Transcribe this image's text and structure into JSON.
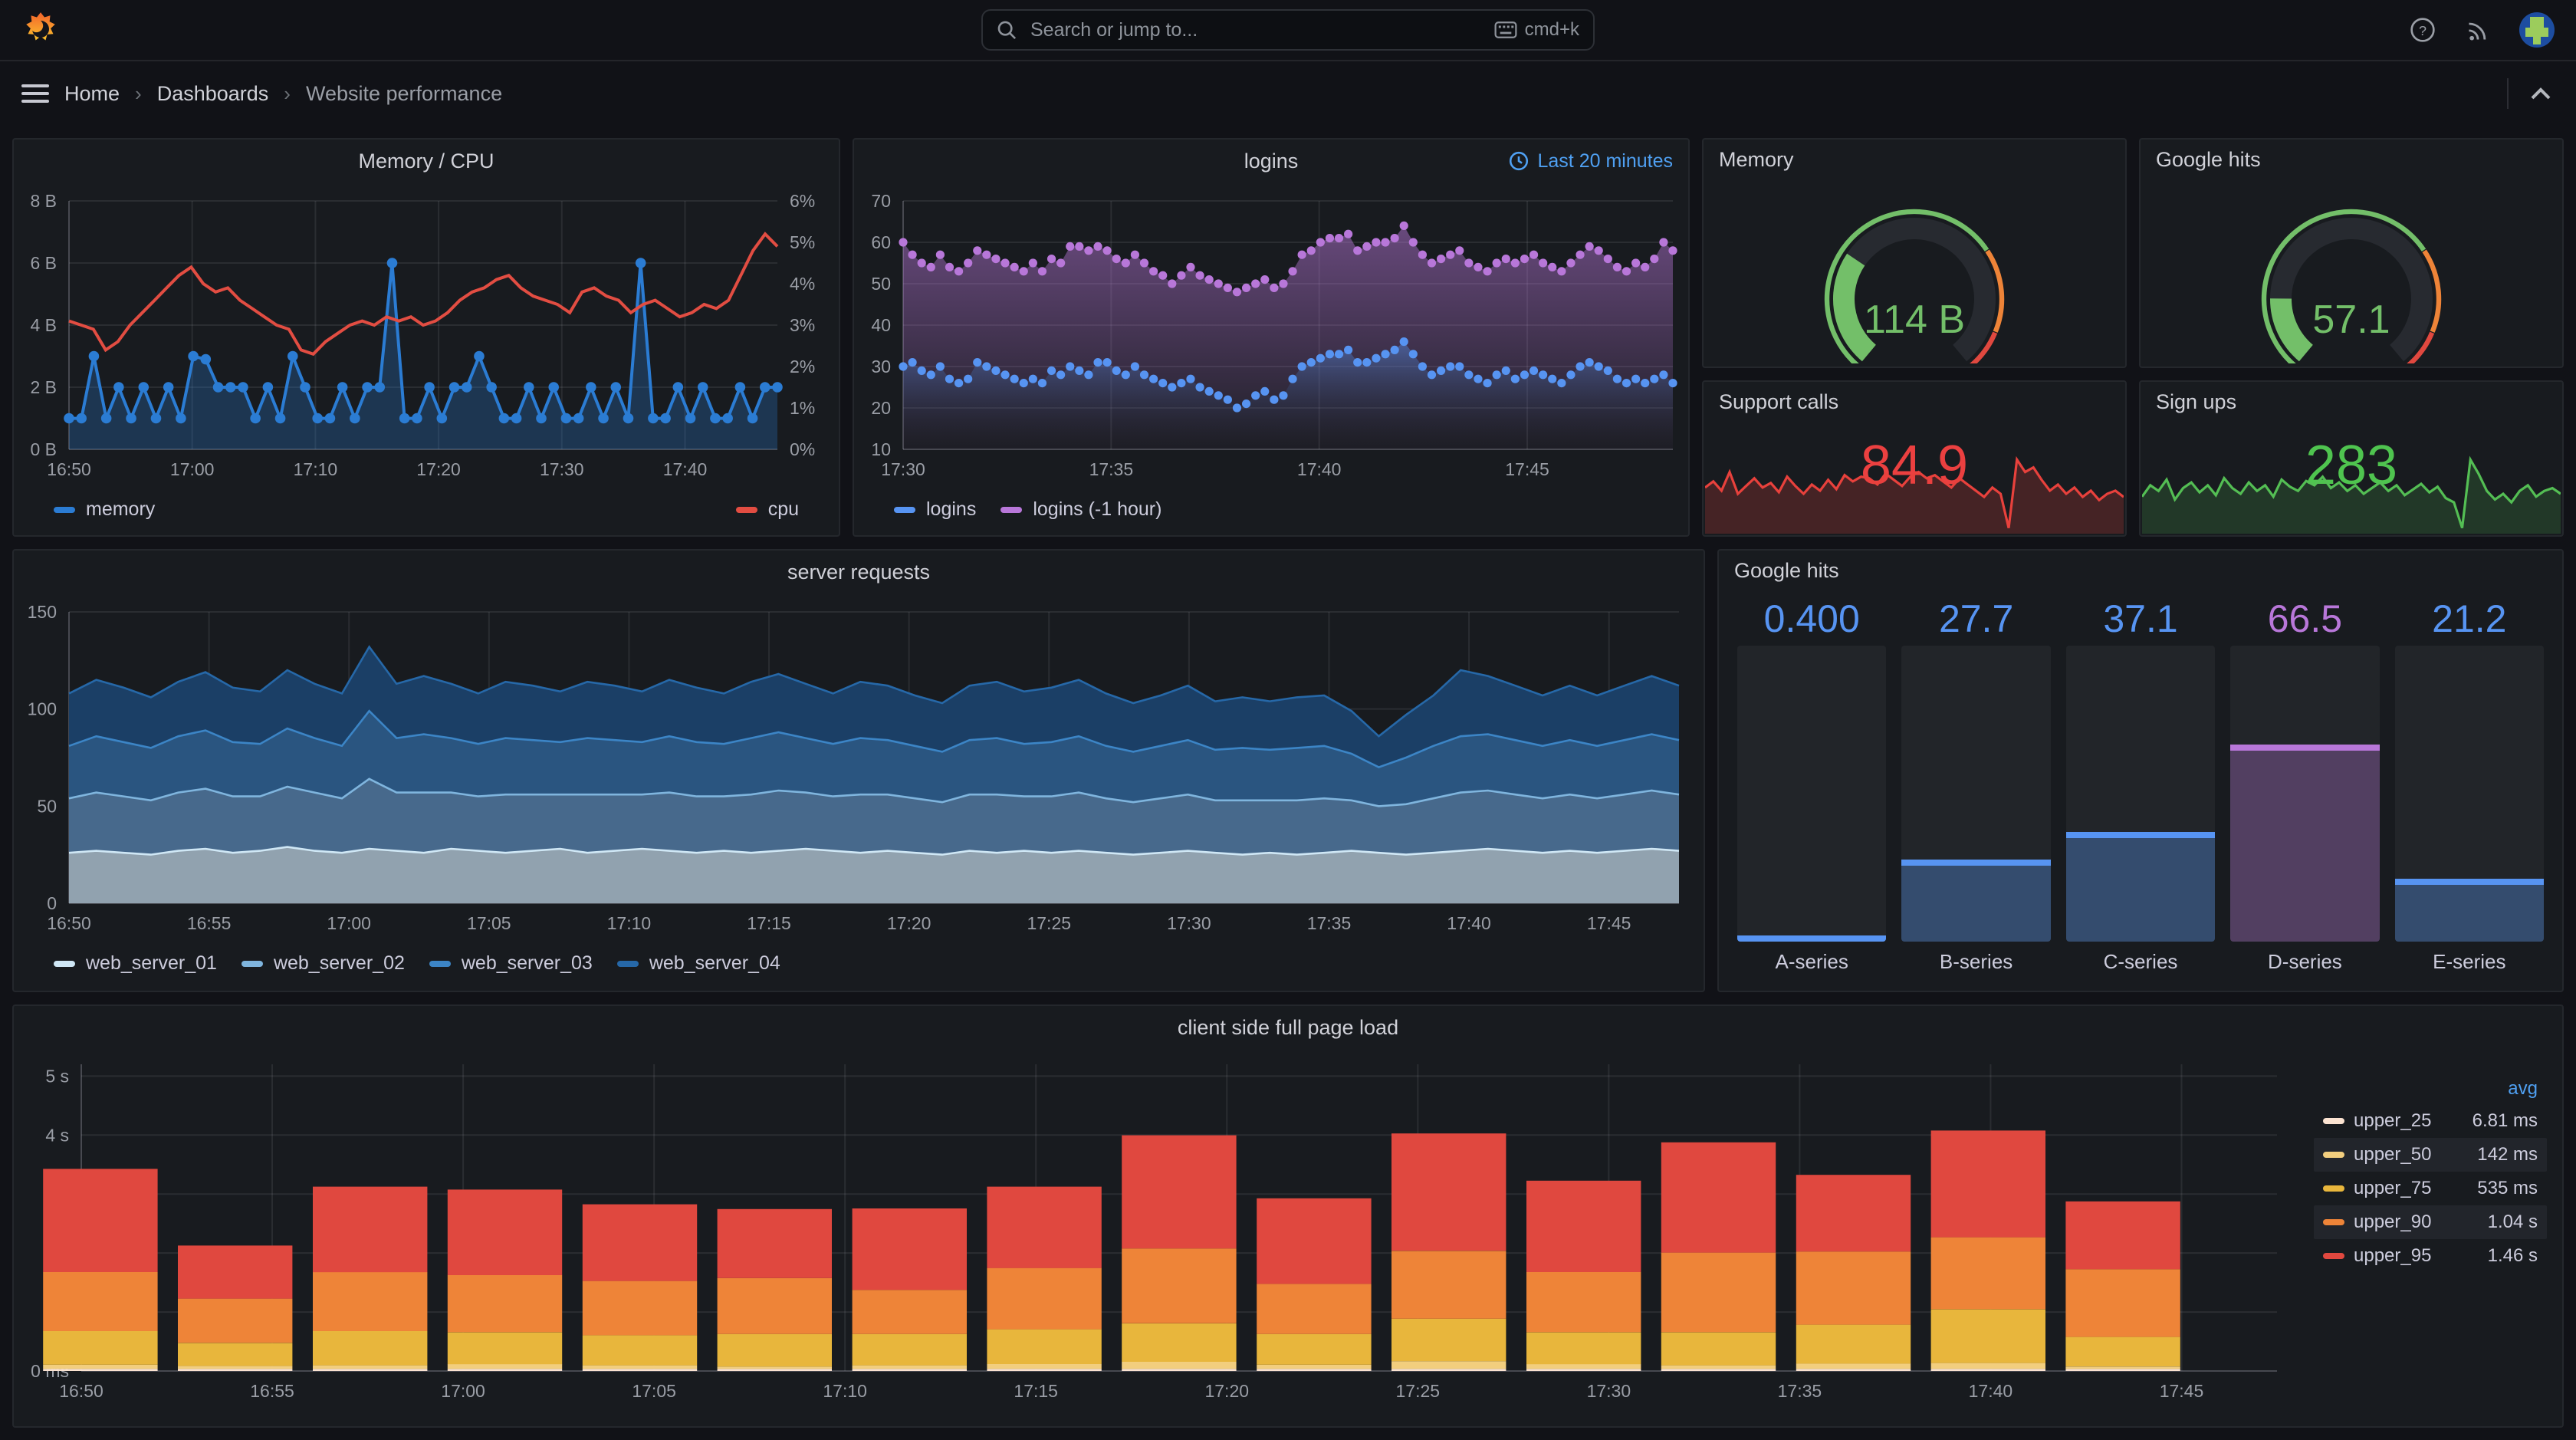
{
  "topbar": {
    "search_placeholder": "Search or jump to...",
    "shortcut": "cmd+k"
  },
  "breadcrumb": {
    "items": [
      "Home",
      "Dashboards",
      "Website performance"
    ]
  },
  "colors": {
    "accent_blue": "#4fa0f2",
    "series_blue": "#5794F2",
    "purple": "#B877D9",
    "green": "#73BF69",
    "red": "#E0483F"
  },
  "chart_data": {
    "memory_cpu": {
      "type": "line",
      "title": "Memory / CPU",
      "x_ticks": [
        "16:50",
        "17:00",
        "17:10",
        "17:20",
        "17:30",
        "17:40"
      ],
      "x_tick_minutes": [
        0,
        10,
        20,
        30,
        40,
        50
      ],
      "total_minutes": 57.5,
      "y_left": {
        "ticks": [
          "0 B",
          "2 B",
          "4 B",
          "6 B",
          "8 B"
        ],
        "max": 8
      },
      "y_right": {
        "ticks": [
          "0%",
          "1%",
          "2%",
          "3%",
          "4%",
          "5%",
          "6%"
        ],
        "max": 6
      },
      "series": [
        {
          "name": "memory",
          "color": "#2B7CD3",
          "fill": "rgba(43,124,211,0.28)",
          "axis": "left",
          "values": [
            1,
            1,
            3,
            1,
            2,
            1,
            2,
            1,
            2,
            1,
            3,
            2.9,
            2,
            2,
            2,
            1,
            2,
            1,
            3,
            2,
            1,
            1,
            2,
            1,
            2,
            2,
            6,
            1,
            1,
            2,
            1,
            2,
            2,
            3,
            2,
            1,
            1,
            2,
            1,
            2,
            1,
            1,
            2,
            1,
            2,
            1,
            6,
            1,
            1,
            2,
            1,
            2,
            1,
            1,
            2,
            1,
            2,
            2
          ]
        },
        {
          "name": "cpu",
          "color": "#E24D42",
          "axis": "right",
          "values": [
            3.1,
            3.0,
            2.9,
            2.4,
            2.6,
            3.0,
            3.3,
            3.6,
            3.9,
            4.2,
            4.4,
            4.0,
            3.8,
            3.9,
            3.6,
            3.4,
            3.2,
            3.0,
            2.9,
            2.4,
            2.3,
            2.6,
            2.8,
            3.0,
            3.1,
            3.0,
            3.2,
            3.1,
            3.2,
            3.0,
            3.1,
            3.3,
            3.6,
            3.8,
            3.9,
            4.1,
            4.2,
            3.9,
            3.7,
            3.6,
            3.5,
            3.3,
            3.8,
            3.9,
            3.7,
            3.6,
            3.3,
            3.5,
            3.6,
            3.4,
            3.2,
            3.3,
            3.5,
            3.4,
            3.6,
            4.2,
            4.8,
            5.2,
            4.9
          ]
        }
      ]
    },
    "logins": {
      "type": "scatter",
      "title": "logins",
      "time_range_label": "Last 20 minutes",
      "x_ticks": [
        "17:30",
        "17:35",
        "17:40",
        "17:45"
      ],
      "x_tick_minutes": [
        0,
        5,
        10,
        15
      ],
      "total_minutes": 18.5,
      "y": {
        "min": 10,
        "max": 70,
        "ticks": [
          "10",
          "20",
          "30",
          "40",
          "50",
          "60",
          "70"
        ]
      },
      "series": [
        {
          "name": "logins",
          "color": "#5794F2",
          "values": [
            30,
            31,
            29,
            28,
            30,
            27,
            26,
            27,
            31,
            30,
            29,
            28,
            27,
            26,
            27,
            26,
            29,
            28,
            30,
            29,
            28,
            31,
            31,
            29,
            28,
            30,
            28,
            27,
            26,
            25,
            26,
            27,
            25,
            24,
            23,
            22,
            20,
            21,
            23,
            24,
            22,
            23,
            27,
            30,
            31,
            32,
            33,
            33,
            34,
            31,
            31,
            32,
            33,
            34,
            36,
            33,
            30,
            28,
            29,
            30,
            30,
            28,
            27,
            26,
            28,
            29,
            27,
            28,
            29,
            28,
            27,
            26,
            28,
            30,
            31,
            30,
            29,
            27,
            26,
            27,
            26,
            27,
            28,
            26
          ]
        },
        {
          "name": "logins (-1 hour)",
          "color": "#B877D9",
          "values": [
            60,
            57,
            55,
            54,
            57,
            54,
            53,
            55,
            58,
            57,
            56,
            55,
            54,
            53,
            55,
            53,
            56,
            55,
            59,
            59,
            58,
            59,
            58,
            56,
            55,
            57,
            55,
            53,
            52,
            50,
            52,
            54,
            52,
            51,
            50,
            49,
            48,
            49,
            50,
            51,
            49,
            50,
            53,
            57,
            58,
            60,
            61,
            61,
            62,
            58,
            59,
            60,
            60,
            61,
            64,
            60,
            57,
            55,
            56,
            57,
            58,
            55,
            54,
            53,
            55,
            56,
            55,
            56,
            57,
            55,
            54,
            53,
            55,
            57,
            59,
            58,
            56,
            54,
            53,
            55,
            54,
            56,
            60,
            58
          ]
        }
      ]
    },
    "memory_gauge": {
      "type": "gauge",
      "title": "Memory",
      "value": "114 B",
      "percent": 0.3,
      "color": "#73BF69",
      "thresholds": [
        {
          "upTo": 0.7,
          "color": "#73BF69"
        },
        {
          "upTo": 0.9,
          "color": "#EE8438"
        },
        {
          "upTo": 1,
          "color": "#E0483F"
        }
      ]
    },
    "google_hits_gauge": {
      "type": "gauge",
      "title": "Google hits",
      "value": "57.1",
      "percent": 0.18,
      "color": "#73BF69",
      "thresholds": [
        {
          "upTo": 0.7,
          "color": "#73BF69"
        },
        {
          "upTo": 0.9,
          "color": "#EE8438"
        },
        {
          "upTo": 1,
          "color": "#E0483F"
        }
      ]
    },
    "support_calls": {
      "type": "stat",
      "title": "Support calls",
      "value": "84.9",
      "color": "#EB4040",
      "line": "#E8413C",
      "fill": "rgba(232,65,60,0.22)",
      "values": [
        78,
        82,
        76,
        88,
        74,
        79,
        84,
        78,
        81,
        75,
        85,
        79,
        74,
        80,
        76,
        83,
        77,
        86,
        82,
        85,
        84,
        80,
        87,
        83,
        79,
        85,
        88,
        84,
        86,
        82,
        78,
        84,
        80,
        76,
        72,
        78,
        74,
        52,
        96,
        88,
        91,
        83,
        76,
        80,
        74,
        78,
        72,
        76,
        70,
        74,
        76,
        72
      ]
    },
    "sign_ups": {
      "type": "stat",
      "title": "Sign ups",
      "value": "283",
      "color": "#4FC44F",
      "line": "#54BE54",
      "fill": "rgba(84,190,84,0.18)",
      "values": [
        62,
        70,
        66,
        74,
        60,
        68,
        72,
        65,
        70,
        63,
        75,
        68,
        64,
        72,
        66,
        70,
        62,
        74,
        69,
        66,
        73,
        70,
        76,
        68,
        72,
        66,
        70,
        64,
        68,
        72,
        66,
        70,
        63,
        67,
        71,
        65,
        69,
        61,
        58,
        40,
        88,
        78,
        66,
        60,
        64,
        58,
        66,
        70,
        62,
        66,
        68,
        64
      ]
    },
    "server_requests": {
      "type": "area",
      "title": "server requests",
      "x_ticks": [
        "16:50",
        "16:55",
        "17:00",
        "17:05",
        "17:10",
        "17:15",
        "17:20",
        "17:25",
        "17:30",
        "17:35",
        "17:40",
        "17:45"
      ],
      "x_tick_minutes": [
        0,
        5,
        10,
        15,
        20,
        25,
        30,
        35,
        40,
        45,
        50,
        55
      ],
      "total_minutes": 57.5,
      "y": {
        "max": 150,
        "ticks": [
          "0",
          "50",
          "100",
          "150"
        ]
      },
      "series": [
        {
          "name": "web_server_01",
          "fill": "#91A2AF",
          "line": "#CFE7F5",
          "values": [
            26,
            27,
            26,
            25,
            27,
            28,
            26,
            27,
            29,
            27,
            26,
            28,
            27,
            26,
            28,
            27,
            26,
            27,
            28,
            26,
            27,
            28,
            27,
            26,
            27,
            26,
            27,
            28,
            27,
            26,
            27,
            26,
            25,
            27,
            26,
            27,
            26,
            27,
            26,
            25,
            26,
            27,
            26,
            25,
            26,
            25,
            26,
            27,
            26,
            25,
            26,
            27,
            28,
            27,
            26,
            27,
            26,
            27,
            28,
            27
          ]
        },
        {
          "name": "web_server_02",
          "fill": "#47698C",
          "line": "#7FB5DE",
          "values": [
            28,
            30,
            29,
            28,
            30,
            31,
            29,
            28,
            31,
            30,
            28,
            36,
            30,
            31,
            29,
            28,
            30,
            29,
            28,
            30,
            29,
            28,
            30,
            29,
            28,
            30,
            31,
            29,
            28,
            30,
            29,
            28,
            27,
            29,
            30,
            28,
            29,
            30,
            28,
            27,
            28,
            29,
            27,
            28,
            27,
            28,
            28,
            26,
            24,
            26,
            28,
            30,
            30,
            29,
            28,
            29,
            28,
            29,
            30,
            29
          ]
        },
        {
          "name": "web_server_03",
          "fill": "#2A5580",
          "line": "#3C85C6",
          "values": [
            27,
            29,
            28,
            27,
            29,
            30,
            28,
            27,
            30,
            28,
            27,
            35,
            28,
            30,
            28,
            27,
            29,
            28,
            27,
            29,
            28,
            27,
            29,
            28,
            27,
            29,
            30,
            28,
            27,
            29,
            28,
            27,
            26,
            28,
            29,
            27,
            28,
            29,
            27,
            26,
            27,
            28,
            26,
            27,
            26,
            27,
            27,
            24,
            20,
            24,
            27,
            29,
            29,
            28,
            27,
            28,
            27,
            28,
            29,
            28
          ]
        },
        {
          "name": "web_server_04",
          "fill": "#1B3F66",
          "line": "#2668A8",
          "values": [
            27,
            29,
            28,
            26,
            28,
            30,
            28,
            27,
            30,
            28,
            27,
            33,
            28,
            30,
            28,
            26,
            29,
            28,
            26,
            29,
            28,
            26,
            29,
            28,
            26,
            29,
            30,
            28,
            26,
            29,
            28,
            26,
            25,
            28,
            29,
            27,
            28,
            29,
            27,
            25,
            26,
            28,
            25,
            26,
            25,
            26,
            26,
            22,
            16,
            22,
            26,
            34,
            30,
            28,
            26,
            28,
            26,
            28,
            30,
            28
          ]
        }
      ]
    },
    "google_hits_bars": {
      "type": "bar",
      "title": "Google hits",
      "max": 100,
      "bars": [
        {
          "label": "A-series",
          "value": "0.400",
          "num": 0.4,
          "color": "#5794F2",
          "fill": "rgba(87,148,242,0.35)"
        },
        {
          "label": "B-series",
          "value": "27.7",
          "num": 27.7,
          "color": "#5794F2",
          "fill": "rgba(87,148,242,0.35)"
        },
        {
          "label": "C-series",
          "value": "37.1",
          "num": 37.1,
          "color": "#5794F2",
          "fill": "rgba(87,148,242,0.35)"
        },
        {
          "label": "D-series",
          "value": "66.5",
          "num": 66.5,
          "color": "#B877D9",
          "fill": "rgba(184,119,217,0.32)"
        },
        {
          "label": "E-series",
          "value": "21.2",
          "num": 21.2,
          "color": "#5794F2",
          "fill": "rgba(87,148,242,0.35)"
        }
      ]
    },
    "client_load": {
      "type": "bar",
      "title": "client side full page load",
      "x_ticks": [
        "16:50",
        "16:55",
        "17:00",
        "17:05",
        "17:10",
        "17:15",
        "17:20",
        "17:25",
        "17:30",
        "17:35",
        "17:40",
        "17:45"
      ],
      "x_tick_minutes": [
        0,
        5,
        10,
        15,
        20,
        25,
        30,
        35,
        40,
        45,
        50,
        55
      ],
      "total_minutes": 57.5,
      "ymax": 5.2,
      "y_ticks": [
        "0 ms",
        "1 s",
        "2 s",
        "3 s",
        "4 s",
        "5 s"
      ],
      "segment_colors": [
        "#FBE3D1",
        "#F2CE7E",
        "#E8B63C",
        "#EE8438",
        "#E0483F"
      ],
      "bars": [
        [
          0.01,
          0.07,
          0.57,
          1.0,
          1.75
        ],
        [
          0.01,
          0.05,
          0.39,
          0.75,
          0.9
        ],
        [
          0.01,
          0.06,
          0.58,
          1.0,
          1.45
        ],
        [
          0.01,
          0.08,
          0.54,
          0.97,
          1.45
        ],
        [
          0.01,
          0.06,
          0.51,
          0.92,
          1.3
        ],
        [
          0.01,
          0.04,
          0.55,
          0.95,
          1.17
        ],
        [
          0.01,
          0.06,
          0.53,
          0.75,
          1.38
        ],
        [
          0.01,
          0.08,
          0.59,
          1.04,
          1.38
        ],
        [
          0.01,
          0.12,
          0.65,
          1.27,
          1.92
        ],
        [
          0.01,
          0.07,
          0.52,
          0.85,
          1.45
        ],
        [
          0.01,
          0.13,
          0.72,
          1.15,
          1.99
        ],
        [
          0.01,
          0.08,
          0.54,
          1.02,
          1.55
        ],
        [
          0.01,
          0.06,
          0.56,
          1.35,
          1.87
        ],
        [
          0.01,
          0.09,
          0.66,
          1.24,
          1.3
        ],
        [
          0.01,
          0.1,
          0.91,
          1.22,
          1.81
        ],
        [
          0.01,
          0.04,
          0.5,
          1.15,
          1.15
        ]
      ],
      "legend": {
        "header": "avg",
        "rows": [
          {
            "name": "upper_25",
            "avg": "6.81 ms",
            "color": "#FBE3D1"
          },
          {
            "name": "upper_50",
            "avg": "142 ms",
            "color": "#F2CE7E"
          },
          {
            "name": "upper_75",
            "avg": "535 ms",
            "color": "#E8B63C"
          },
          {
            "name": "upper_90",
            "avg": "1.04 s",
            "color": "#EE8438"
          },
          {
            "name": "upper_95",
            "avg": "1.46 s",
            "color": "#E0483F"
          }
        ]
      }
    }
  }
}
